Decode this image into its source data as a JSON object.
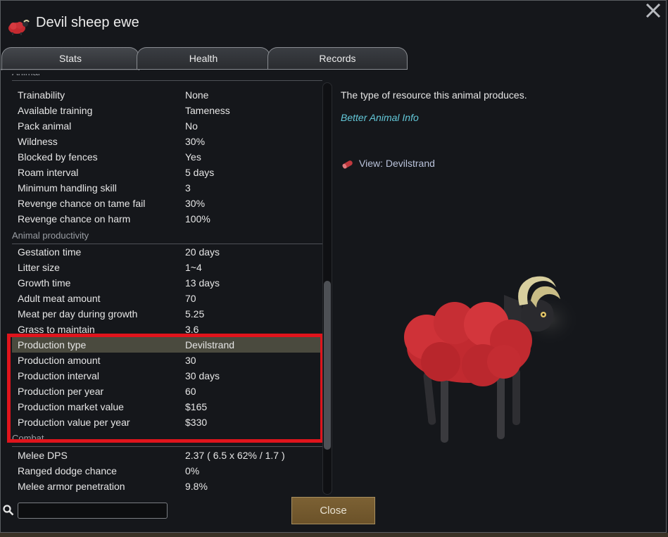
{
  "window": {
    "title": "Devil sheep ewe",
    "title_icon": "devil-sheep-icon",
    "close_icon": "close-icon"
  },
  "tabs": [
    {
      "label": "Stats",
      "active": true
    },
    {
      "label": "Health",
      "active": false
    },
    {
      "label": "Records",
      "active": false
    }
  ],
  "sections": {
    "animal": "Animal",
    "productivity": "Animal productivity",
    "combat": "Combat"
  },
  "animal_rows": [
    {
      "label": "Trainability",
      "value": "None"
    },
    {
      "label": "Available training",
      "value": "Tameness"
    },
    {
      "label": "Pack animal",
      "value": "No"
    },
    {
      "label": "Wildness",
      "value": "30%"
    },
    {
      "label": "Blocked by fences",
      "value": "Yes"
    },
    {
      "label": "Roam interval",
      "value": "5 days"
    },
    {
      "label": "Minimum handling skill",
      "value": "3"
    },
    {
      "label": "Revenge chance on tame fail",
      "value": "30%"
    },
    {
      "label": "Revenge chance on harm",
      "value": "100%"
    }
  ],
  "productivity_rows": [
    {
      "label": "Gestation time",
      "value": "20 days"
    },
    {
      "label": "Litter size",
      "value": "1~4"
    },
    {
      "label": "Growth time",
      "value": "13 days"
    },
    {
      "label": "Adult meat amount",
      "value": "70"
    },
    {
      "label": "Meat per day during growth",
      "value": "5.25"
    },
    {
      "label": "Grass to maintain",
      "value": "3.6"
    },
    {
      "label": "Production type",
      "value": "Devilstrand",
      "selected": true
    },
    {
      "label": "Production amount",
      "value": "30"
    },
    {
      "label": "Production interval",
      "value": "30 days"
    },
    {
      "label": "Production per year",
      "value": "60"
    },
    {
      "label": "Production market value",
      "value": "$165"
    },
    {
      "label": "Production value per year",
      "value": "$330"
    }
  ],
  "combat_rows": [
    {
      "label": "Melee DPS",
      "value": "2.37 ( 6.5 x 62% / 1.7 )"
    },
    {
      "label": "Ranged dodge chance",
      "value": "0%"
    },
    {
      "label": "Melee armor penetration",
      "value": "9.8%"
    }
  ],
  "detail": {
    "description": "The type of resource this animal produces.",
    "link": "Better Animal Info",
    "view_label": "View: Devilstrand",
    "view_icon": "devilstrand-icon"
  },
  "search": {
    "value": "",
    "placeholder": "",
    "icon": "search-icon"
  },
  "close_button": "Close",
  "colors": {
    "background": "#15171b",
    "highlight_row": "#4a4a3e",
    "annotation_box": "#e0141c",
    "link": "#63c8d9",
    "button": "#7c6134"
  }
}
